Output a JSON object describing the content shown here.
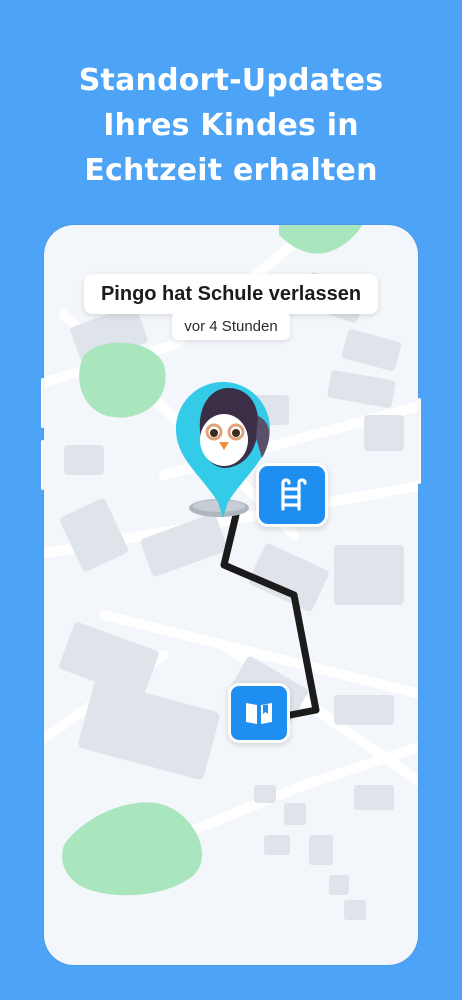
{
  "headline": {
    "line1": "Standort-Updates",
    "line2": "Ihres Kindes in",
    "line3": "Echtzeit erhalten"
  },
  "event": {
    "title": "Pingo hat Schule verlassen",
    "time_ago": "vor 4 Stunden"
  },
  "markers": {
    "child_avatar_icon": "penguin-avatar-icon",
    "pool_icon": "swimming-pool-icon",
    "school_icon": "book-icon"
  },
  "colors": {
    "background": "#4da3f5",
    "phone_screen": "#f3f6fa",
    "marker_blue": "#1f8ef1",
    "avatar_cyan": "#33cbe7",
    "park_green": "#a9e6bd",
    "route": "#1b1b1b"
  }
}
